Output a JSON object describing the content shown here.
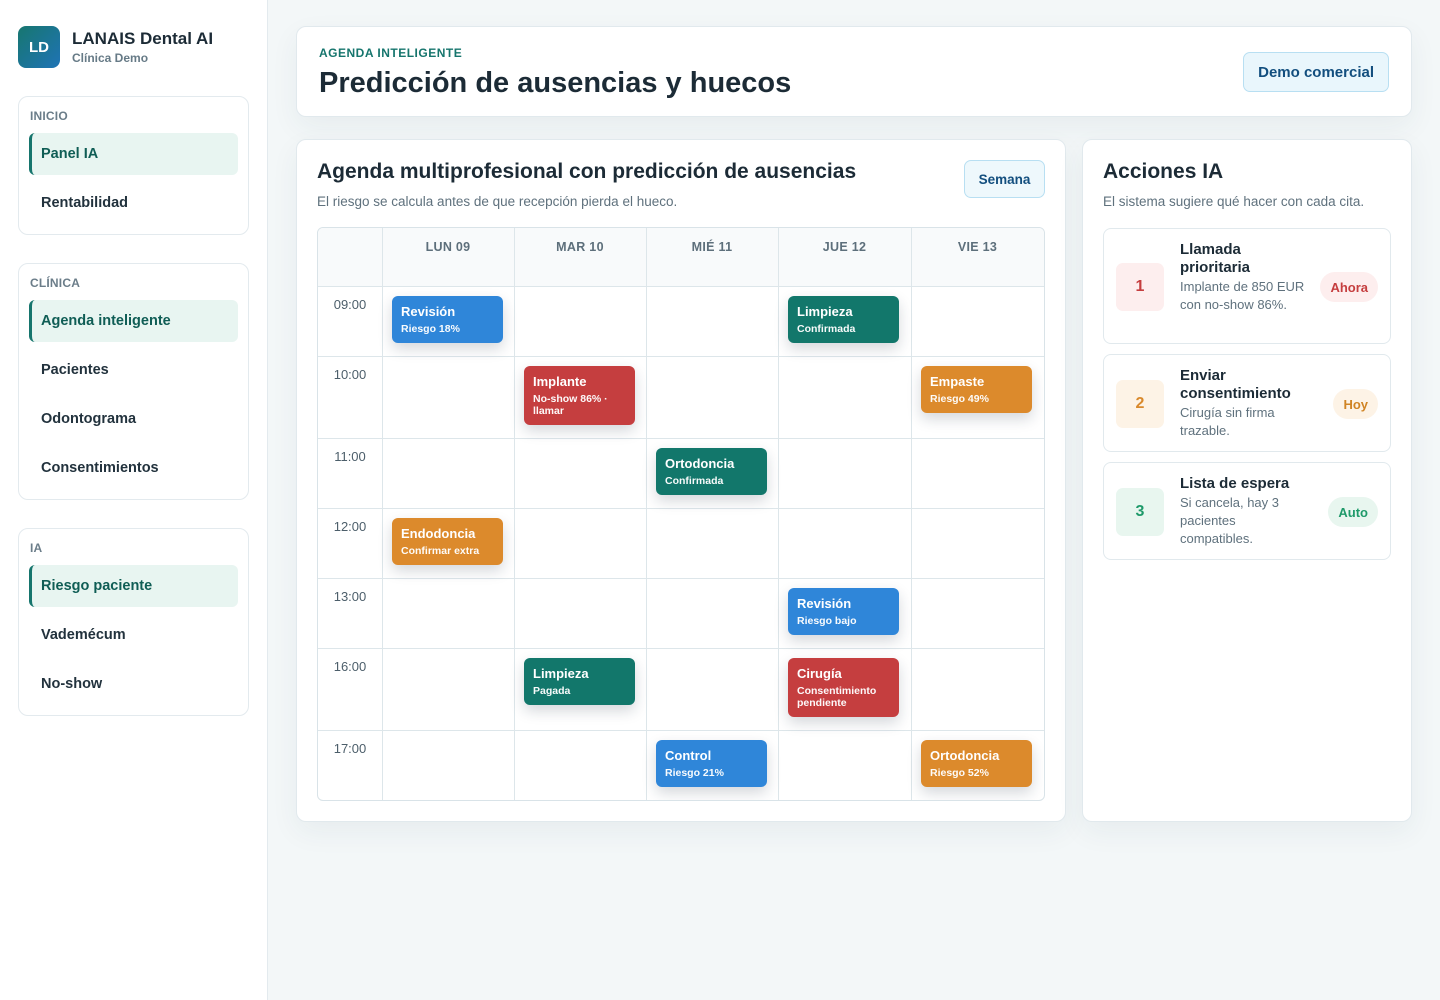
{
  "brand": {
    "logo": "LD",
    "name": "LANAIS Dental AI",
    "sub": "Clínica Demo"
  },
  "nav": [
    {
      "heading": "INICIO",
      "items": [
        {
          "label": "Panel IA",
          "active": true
        },
        {
          "label": "Rentabilidad",
          "active": false
        }
      ]
    },
    {
      "heading": "CLÍNICA",
      "items": [
        {
          "label": "Agenda inteligente",
          "active": true
        },
        {
          "label": "Pacientes",
          "active": false
        },
        {
          "label": "Odontograma",
          "active": false
        },
        {
          "label": "Consentimientos",
          "active": false
        }
      ]
    },
    {
      "heading": "IA",
      "items": [
        {
          "label": "Riesgo paciente",
          "active": true
        },
        {
          "label": "Vademécum",
          "active": false
        },
        {
          "label": "No-show",
          "active": false
        }
      ]
    }
  ],
  "header": {
    "eyebrow": "AGENDA INTELIGENTE",
    "title": "Predicción de ausencias y huecos",
    "demo_label": "Demo comercial"
  },
  "agenda": {
    "title": "Agenda multiprofesional con predicción de ausencias",
    "subtitle": "El riesgo se calcula antes de que recepción pierda el hueco.",
    "week_label": "Semana",
    "days": [
      "LUN 09",
      "MAR 10",
      "MIÉ 11",
      "JUE 12",
      "VIE 13"
    ],
    "times": [
      "09:00",
      "10:00",
      "11:00",
      "12:00",
      "13:00",
      "16:00",
      "17:00"
    ],
    "appointments": [
      {
        "day": 0,
        "time": 0,
        "title": "Revisión",
        "sub": "Riesgo 18%",
        "color": "#2f86d9"
      },
      {
        "day": 3,
        "time": 0,
        "title": "Limpieza",
        "sub": "Confirmada",
        "color": "#12776b"
      },
      {
        "day": 1,
        "time": 1,
        "title": "Implante",
        "sub": "No-show 86% · llamar",
        "color": "#c53e3f"
      },
      {
        "day": 4,
        "time": 1,
        "title": "Empaste",
        "sub": "Riesgo 49%",
        "color": "#dc8a2c"
      },
      {
        "day": 2,
        "time": 2,
        "title": "Ortodoncia",
        "sub": "Confirmada",
        "color": "#12776b"
      },
      {
        "day": 0,
        "time": 3,
        "title": "Endodoncia",
        "sub": "Confirmar extra",
        "color": "#dc8a2c"
      },
      {
        "day": 3,
        "time": 4,
        "title": "Revisión",
        "sub": "Riesgo bajo",
        "color": "#2f86d9"
      },
      {
        "day": 1,
        "time": 5,
        "title": "Limpieza",
        "sub": "Pagada",
        "color": "#12776b"
      },
      {
        "day": 3,
        "time": 5,
        "title": "Cirugía",
        "sub": "Consentimiento pendiente",
        "color": "#c53e3f"
      },
      {
        "day": 2,
        "time": 6,
        "title": "Control",
        "sub": "Riesgo 21%",
        "color": "#2f86d9"
      },
      {
        "day": 4,
        "time": 6,
        "title": "Ortodoncia",
        "sub": "Riesgo 52%",
        "color": "#dc8a2c"
      }
    ]
  },
  "actions": {
    "title": "Acciones IA",
    "subtitle": "El sistema sugiere qué hacer con cada cita.",
    "items": [
      {
        "num": "1",
        "title": "Llamada prioritaria",
        "desc": "Implante de 850 EUR con no-show 86%.",
        "pill": "Ahora",
        "num_color": "#c53e3f",
        "num_bg": "#fdeeee",
        "pill_color": "#c53e3f",
        "pill_bg": "#fdeeee"
      },
      {
        "num": "2",
        "title": "Enviar consentimiento",
        "desc": "Cirugía sin firma trazable.",
        "pill": "Hoy",
        "num_color": "#d9892c",
        "num_bg": "#fdf3e6",
        "pill_color": "#d08424",
        "pill_bg": "#fdf3e6"
      },
      {
        "num": "3",
        "title": "Lista de espera",
        "desc": "Si cancela, hay 3 pacientes compatibles.",
        "pill": "Auto",
        "num_color": "#1f9a6a",
        "num_bg": "#e8f6ef",
        "pill_color": "#1f9a6a",
        "pill_bg": "#e8f6ef"
      }
    ]
  }
}
